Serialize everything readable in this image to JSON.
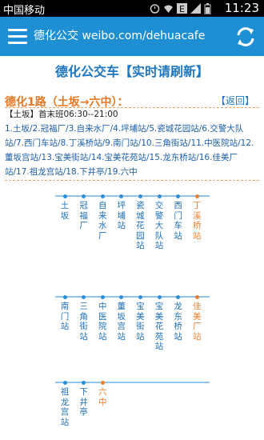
{
  "status_bar": {
    "carrier": "中国移动",
    "time": "11:23"
  },
  "app_bar": {
    "title": "德化公交 weibo.com/dehuacafe"
  },
  "page_title": "德化公交车【实时请刷新】",
  "route": {
    "name": "德化1路（土坂→六中）：",
    "back_label": "【返回】",
    "schedule": "【土坂】首末班06:30--21:00",
    "stops_text": "1.土坂/2.冠福厂/3.自来水厂/4.坪埔站/5.瓷城花园站/6.交警大队站/7.西门车站/8.丁溪桥站/9.南门站/10.三角街站/11.中医院站/12.董坂宫站/13.宝美街站/14.宝美花苑站/15.龙东桥站/16.佳美厂站/17.祖龙宫站/18.下井亭/19.六中"
  },
  "stops": [
    "土坂",
    "冠福厂",
    "自来水厂",
    "坪埔站",
    "瓷城花园站",
    "交警大队站",
    "西门车站",
    "丁溪桥站",
    "南门站",
    "三角街站",
    "中医院站",
    "董坂宫站",
    "宝美街站",
    "宝美花苑站",
    "龙东桥站",
    "佳美厂站",
    "祖龙宫站",
    "下井亭",
    "六中"
  ],
  "colors": {
    "accent": "#1d8fd2",
    "highlight": "#f08030"
  },
  "icons": [
    "menu-icon",
    "refresh-icon"
  ]
}
